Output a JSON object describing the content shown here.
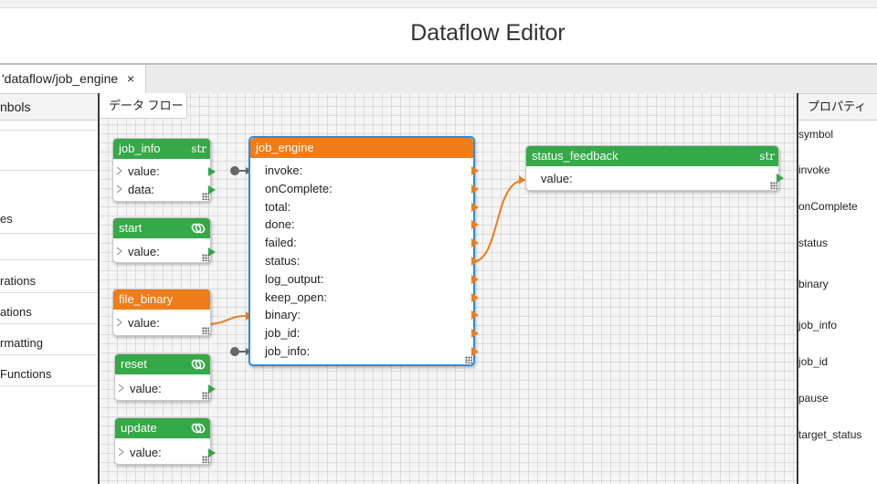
{
  "app": {
    "title": "Dataflow Editor"
  },
  "tab": {
    "label": "'dataflow/job_engine",
    "close": "×"
  },
  "left_panel": {
    "header": "nbols",
    "items": [
      "es",
      "rations",
      "ations",
      "rmatting",
      "Functions"
    ]
  },
  "canvas": {
    "tab_label": "データ フロー"
  },
  "nodes": {
    "job_info": {
      "title": "job_info",
      "type": "str",
      "ports": [
        "value:",
        "data:"
      ]
    },
    "start": {
      "title": "start",
      "ports": [
        "value:"
      ]
    },
    "file_binary": {
      "title": "file_binary",
      "ports": [
        "value:"
      ]
    },
    "reset": {
      "title": "reset",
      "ports": [
        "value:"
      ]
    },
    "update": {
      "title": "update",
      "ports": [
        "value:"
      ]
    },
    "job_engine": {
      "title": "job_engine",
      "ports": [
        "invoke:",
        "onComplete:",
        "total:",
        "done:",
        "failed:",
        "status:",
        "log_output:",
        "keep_open:",
        "binary:",
        "job_id:",
        "job_info:"
      ]
    },
    "status_feedback": {
      "title": "status_feedback",
      "type": "str",
      "ports": [
        "value:"
      ]
    }
  },
  "right_panel": {
    "header": "プロパティ",
    "props": [
      "symbol",
      "invoke",
      "onComplete",
      "status",
      "binary",
      "job_info",
      "job_id",
      "pause",
      "target_status"
    ]
  },
  "colors": {
    "green": "#35a848",
    "orange": "#ef7d1a",
    "selected": "#2f8bd9"
  }
}
